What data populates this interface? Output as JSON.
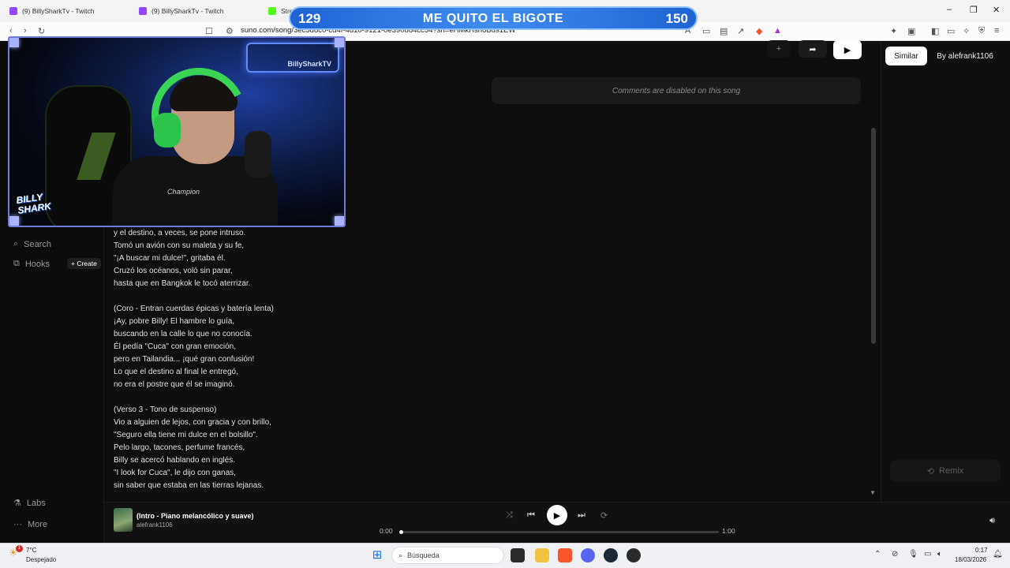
{
  "browser": {
    "tabs": [
      {
        "title": "(9) BillySharkTv - Twitch"
      },
      {
        "title": "(9) BillySharkTv - Twitch"
      },
      {
        "title": "Stre"
      }
    ],
    "url": "suno.com/song/3ec5d8c0-cd4f-4d10-9121-0e390884cc54?sh=eHMkHsn6Bus1EW"
  },
  "overlay": {
    "banner": {
      "left_count": "129",
      "message": "ME QUITO EL BIGOTE",
      "right_count": "150"
    },
    "webcam": {
      "sign_text": "BillySharkTV",
      "logo_text": "BILLY SHARK",
      "shirt_text": "Champion"
    }
  },
  "sidebar": {
    "items": [
      {
        "label": "Search",
        "icon": "search-icon"
      },
      {
        "label": "Hooks",
        "icon": "hooks-icon"
      }
    ],
    "create_label": "+ Create",
    "bottom_items": [
      {
        "label": "Labs",
        "icon": "flask-icon"
      },
      {
        "label": "More",
        "icon": "more-icon"
      }
    ]
  },
  "song": {
    "comments_disabled": "Comments are disabled on this song",
    "lyrics_block_1": "y el destino, a veces, se pone intruso.\nTomó un avión con su maleta y su fe,\n\"¡A buscar mi dulce!\", gritaba él.\nCruzó los océanos, voló sin parar,\nhasta que en Bangkok le tocó aterrizar.",
    "lyrics_block_2": "(Coro - Entran cuerdas épicas y batería lenta)\n¡Ay, pobre Billy! El hambre lo guía,\nbuscando en la calle lo que no conocía.\nÉl pedía \"Cuca\" con gran emoción,\npero en Tailandia... ¡qué gran confusión!\nLo que el destino al final le entregó,\nno era el postre que él se imaginó.",
    "lyrics_block_3": "(Verso 3 - Tono de suspenso)\nVio a alguien de lejos, con gracia y con brillo,\n\"Seguro ella tiene mi dulce en el bolsillo\".\nPelo largo, tacones, perfume francés,\nBilly se acercó hablando en inglés.\n\"I look for Cuca\", le dijo con ganas,\nsin saber que estaba en las tierras lejanas."
  },
  "right_panel": {
    "similar_label": "Similar",
    "by_label": "By alefrank1106",
    "remix_label": "Remix"
  },
  "toolbar": {
    "add_label": "+"
  },
  "player": {
    "title": "(Intro - Piano melancólico y suave)",
    "artist": "alefrank1106",
    "current_time": "0:00",
    "duration": "1:00",
    "progress": 0.0
  },
  "taskbar": {
    "weather_temp": "7°C",
    "weather_desc": "Despejado",
    "search_placeholder": "Búsqueda",
    "time": "0:17",
    "date": "18/03/2026"
  },
  "colors": {
    "accent_banner": "#2f7ae8",
    "app_bg": "#0e0e0e",
    "headphone_green": "#39d454"
  }
}
